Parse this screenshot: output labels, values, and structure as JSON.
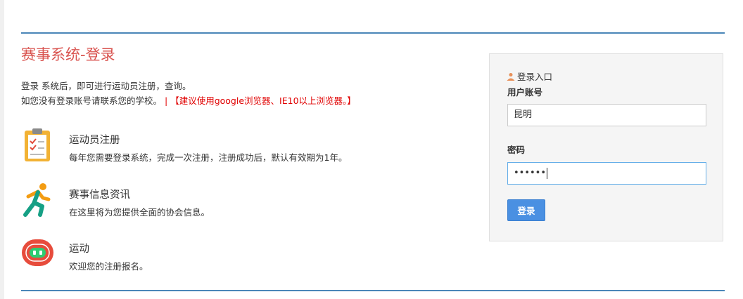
{
  "page": {
    "title": "赛事系统-登录",
    "intro_line1": "登录 系统后，即可进行运动员注册，查询。",
    "intro_line2": "如您没有登录账号请联系您的学校。",
    "separator": "|",
    "browser_notice": "【建议使用google浏览器、IE10以上浏览器。】"
  },
  "features": [
    {
      "icon": "clipboard-checklist-icon",
      "title": "运动员注册",
      "desc": "每年您需要登录系统，完成一次注册，注册成功后，默认有效期为1年。"
    },
    {
      "icon": "runner-icon",
      "title": "赛事信息资讯",
      "desc": "在这里将为您提供全面的协会信息。"
    },
    {
      "icon": "running-track-icon",
      "title": "运动",
      "desc": "欢迎您的注册报名。"
    }
  ],
  "login": {
    "header": "登录入口",
    "username_label": "用户账号",
    "username_value": "昆明",
    "password_label": "密码",
    "password_masked": "••••••",
    "button_label": "登录"
  },
  "colors": {
    "title_red": "#d9534f",
    "notice_red": "#e00000",
    "rule_blue": "#4a86b8",
    "button_blue": "#4a90e2"
  }
}
